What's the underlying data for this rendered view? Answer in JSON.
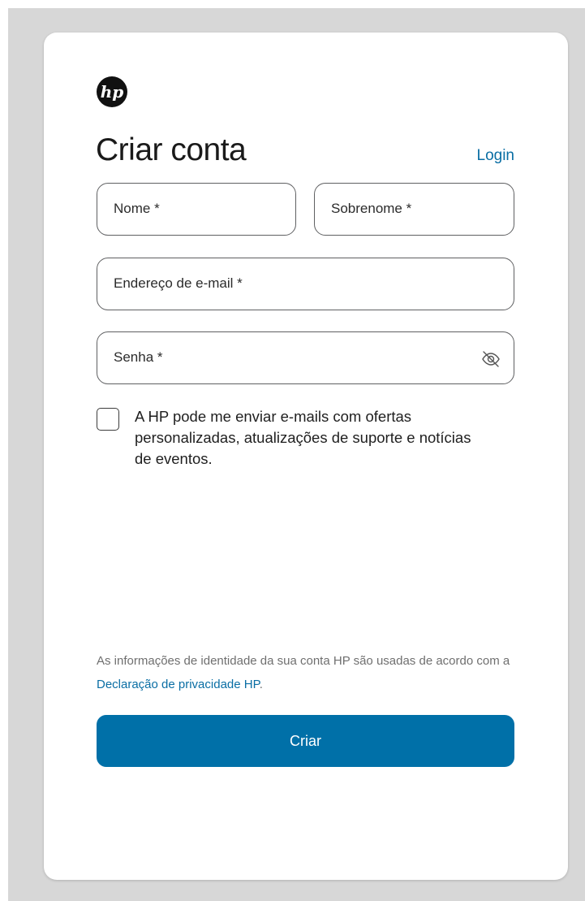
{
  "brand": {
    "logo_icon": "hp-logo-icon",
    "accent_color": "#0070a8",
    "link_color": "#0a6ea4"
  },
  "header": {
    "title": "Criar conta",
    "login_link": "Login"
  },
  "form": {
    "first_name_label": "Nome *",
    "last_name_label": "Sobrenome *",
    "email_label": "Endereço de e-mail *",
    "password_label": "Senha *",
    "password_toggle_icon": "eye-slash-icon",
    "consent_checked": false,
    "consent_text": "A HP pode me enviar e-mails com ofertas personalizadas, atualizações de suporte e notícias de eventos."
  },
  "footer": {
    "privacy_text": "As informações de identidade da sua conta HP são usadas de acordo com a ",
    "privacy_link": "Declaração de privacidade HP",
    "privacy_end": ".",
    "submit_label": "Criar"
  }
}
